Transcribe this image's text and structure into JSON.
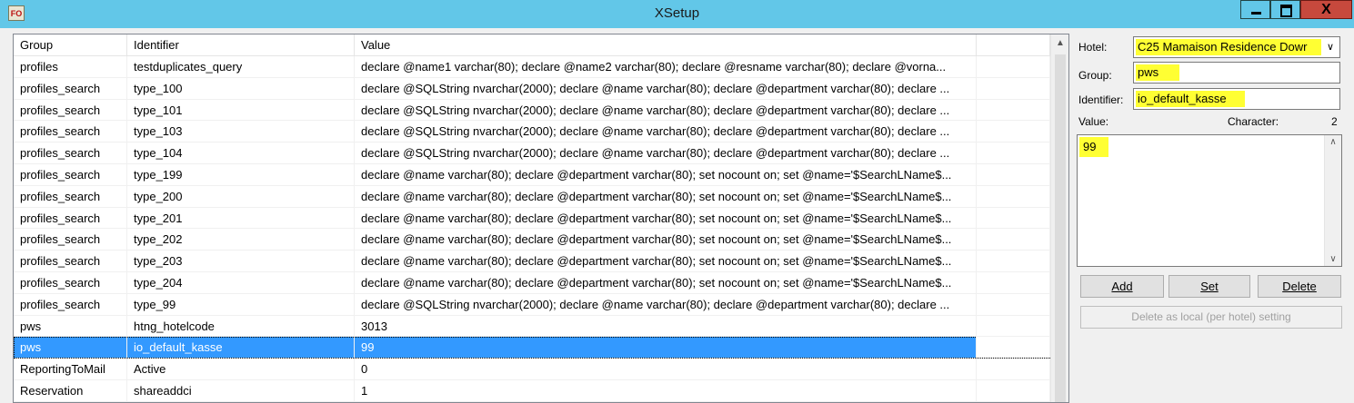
{
  "window": {
    "title": "XSetup",
    "app_icon_text": "FO",
    "close_glyph": "X"
  },
  "grid": {
    "columns": [
      "Group",
      "Identifier",
      "Value",
      ""
    ],
    "rows": [
      {
        "group": "profiles",
        "identifier": "testduplicates_query",
        "value": "declare @name1 varchar(80); declare @name2 varchar(80); declare @resname varchar(80); declare @vorna..."
      },
      {
        "group": "profiles_search",
        "identifier": "type_100",
        "value": "declare @SQLString nvarchar(2000); declare @name varchar(80); declare @department varchar(80); declare ..."
      },
      {
        "group": "profiles_search",
        "identifier": "type_101",
        "value": "declare @SQLString nvarchar(2000); declare @name varchar(80); declare @department varchar(80); declare ..."
      },
      {
        "group": "profiles_search",
        "identifier": "type_103",
        "value": "declare @SQLString nvarchar(2000); declare @name varchar(80); declare @department varchar(80); declare ..."
      },
      {
        "group": "profiles_search",
        "identifier": "type_104",
        "value": "declare @SQLString nvarchar(2000); declare @name varchar(80); declare @department varchar(80); declare ..."
      },
      {
        "group": "profiles_search",
        "identifier": "type_199",
        "value": "declare @name varchar(80); declare @department varchar(80); set nocount on; set @name='$SearchLName$..."
      },
      {
        "group": "profiles_search",
        "identifier": "type_200",
        "value": "declare @name varchar(80); declare @department varchar(80); set nocount on; set @name='$SearchLName$..."
      },
      {
        "group": "profiles_search",
        "identifier": "type_201",
        "value": "declare @name varchar(80); declare @department varchar(80); set nocount on; set @name='$SearchLName$..."
      },
      {
        "group": "profiles_search",
        "identifier": "type_202",
        "value": "declare @name varchar(80); declare @department varchar(80); set nocount on; set @name='$SearchLName$..."
      },
      {
        "group": "profiles_search",
        "identifier": "type_203",
        "value": "declare @name varchar(80); declare @department varchar(80); set nocount on; set @name='$SearchLName$..."
      },
      {
        "group": "profiles_search",
        "identifier": "type_204",
        "value": "declare @name varchar(80); declare @department varchar(80); set nocount on; set @name='$SearchLName$..."
      },
      {
        "group": "profiles_search",
        "identifier": "type_99",
        "value": "declare @SQLString nvarchar(2000); declare @name varchar(80); declare @department varchar(80); declare ..."
      },
      {
        "group": "pws",
        "identifier": "htng_hotelcode",
        "value": "3013"
      },
      {
        "group": "pws",
        "identifier": "io_default_kasse",
        "value": "99",
        "selected": true
      },
      {
        "group": "ReportingToMail",
        "identifier": "Active",
        "value": "0"
      },
      {
        "group": "Reservation",
        "identifier": "shareaddci",
        "value": "1"
      }
    ]
  },
  "panel": {
    "hotel_label": "Hotel:",
    "hotel_value": "C25 Mamaison Residence Dowr",
    "group_label": "Group:",
    "group_value": "pws",
    "identifier_label": "Identifier:",
    "identifier_value": "io_default_kasse",
    "value_label": "Value:",
    "character_label": "Character:",
    "character_count": "2",
    "value_text": "99",
    "add_label": "Add",
    "set_label": "Set",
    "delete_label": "Delete",
    "delete_local_label": "Delete as local (per hotel) setting"
  },
  "colors": {
    "titlebar": "#62c7e8",
    "selection": "#3399ff",
    "highlight": "#ffff33",
    "close_button": "#c7493d"
  },
  "icons": [
    "app-icon",
    "minimize-icon",
    "maximize-icon",
    "close-icon",
    "scroll-up-icon",
    "dropdown-arrow-icon"
  ]
}
